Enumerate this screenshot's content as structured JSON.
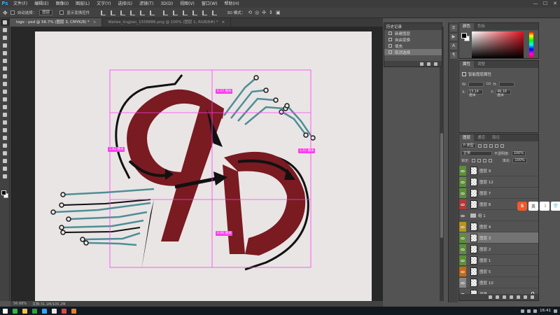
{
  "app": {
    "logo": "Ps"
  },
  "menu": [
    "文件(F)",
    "编辑(E)",
    "图像(I)",
    "图层(L)",
    "文字(Y)",
    "选择(S)",
    "滤镜(T)",
    "3D(D)",
    "视图(V)",
    "窗口(W)",
    "帮助(H)"
  ],
  "window_controls": [
    "—",
    "☐",
    "✕"
  ],
  "options": {
    "auto_select_label": "自动选择：",
    "auto_select_value": "图层",
    "transform_label": "显示变换控件",
    "mode_3d": "3D 模式："
  },
  "doc_tabs": [
    {
      "label": "logo - psd @ 56.7% (图层 3, CMYK/8) *",
      "active": true
    },
    {
      "label": "Wallee_lingjian_1558886.png @ 100% (图层 1, RGB/8#) *",
      "active": false
    }
  ],
  "guide_tags": [
    {
      "label": "6.27 厘米"
    },
    {
      "label": "1.82 厘米"
    },
    {
      "label": "1.57 厘米"
    },
    {
      "label": "6.06 厘米"
    }
  ],
  "status": {
    "zoom": "56.68%",
    "doc": "文档:31.1M/105.2M"
  },
  "history": {
    "title": "历史记录",
    "items": [
      {
        "label": "新建图层",
        "active": false
      },
      {
        "label": "自由变换",
        "active": false
      },
      {
        "label": "填充",
        "active": false
      },
      {
        "label": "取消选择",
        "active": true
      }
    ]
  },
  "color_panel": {
    "tabs": [
      "颜色",
      "色板"
    ]
  },
  "properties": {
    "tabs": [
      "属性",
      "调整"
    ],
    "title": "智能图层属性",
    "w_label": "W:",
    "h_label": "H:",
    "x_label": "X:",
    "x_value": "13.14 厘米",
    "y_label": "Y:",
    "y_value": "46.16 厘米",
    "link": "GO"
  },
  "layers_panel": {
    "tabs": [
      "图层",
      "通道",
      "路径"
    ],
    "filter_label": "P 类型",
    "blend_mode": "正常",
    "opacity_label": "不透明度:",
    "opacity_value": "100%",
    "lock_label": "锁定:",
    "fill_label": "填充:",
    "fill_value": "100%",
    "layers": [
      {
        "name": "图层 9",
        "color": "#5d8f3a",
        "selected": false,
        "type": "layer"
      },
      {
        "name": "图层 12",
        "color": "#5d8f3a",
        "selected": false,
        "type": "layer"
      },
      {
        "name": "图层 7",
        "color": "#5d8f3a",
        "selected": false,
        "type": "layer"
      },
      {
        "name": "图层 8",
        "color": "#b33a3a",
        "selected": false,
        "type": "layer"
      },
      {
        "name": "组 1",
        "color": "",
        "selected": false,
        "type": "group"
      },
      {
        "name": "图层 4",
        "color": "#b8941f",
        "selected": false,
        "type": "layer"
      },
      {
        "name": "图层 3",
        "color": "#5d8f3a",
        "selected": true,
        "type": "layer"
      },
      {
        "name": "图层 2",
        "color": "#5d8f3a",
        "selected": false,
        "type": "layer"
      },
      {
        "name": "图层 1",
        "color": "#5d8f3a",
        "selected": false,
        "type": "layer"
      },
      {
        "name": "图层 5",
        "color": "#c66a14",
        "selected": false,
        "type": "layer"
      },
      {
        "name": "图层 10",
        "color": "#888888",
        "selected": false,
        "type": "layer"
      },
      {
        "name": "背景",
        "color": "",
        "selected": false,
        "type": "background"
      }
    ]
  },
  "ime": {
    "items": [
      "S",
      "英",
      "☽",
      "👕"
    ]
  },
  "taskbar": {
    "time": "16:41"
  },
  "colors": {
    "logo_red": "#7a1a21",
    "circuit_teal": "#4f8e96",
    "guide": "#ff3cf0"
  }
}
